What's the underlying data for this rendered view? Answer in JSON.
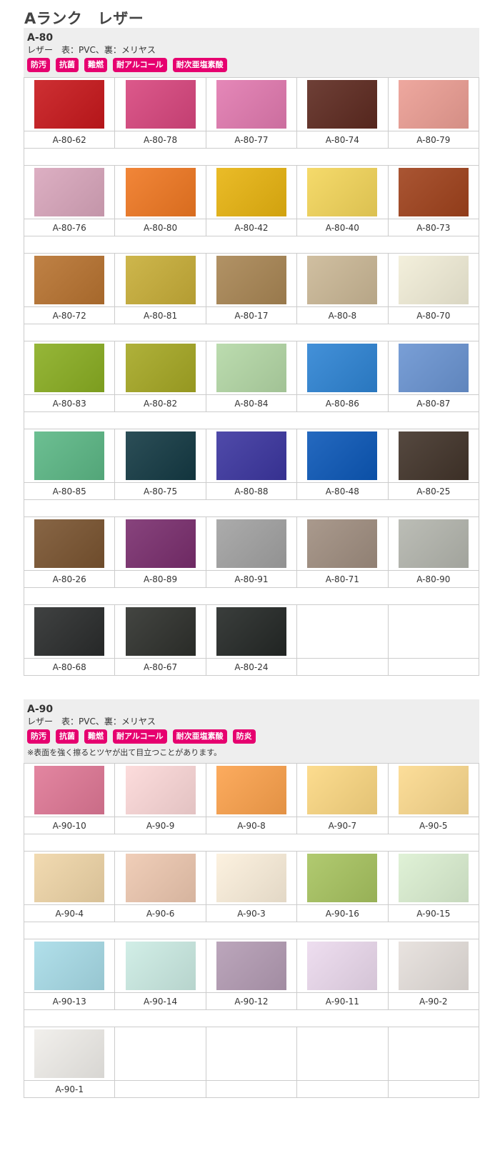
{
  "page_title": "Aランク　レザー",
  "sections": [
    {
      "title": "A-80",
      "spec": "レザー　表：PVC、裏：メリヤス",
      "tags": [
        "防汚",
        "抗菌",
        "難燃",
        "耐アルコール",
        "耐次亜塩素酸"
      ],
      "note": "",
      "rows": [
        [
          {
            "code": "A-80-62",
            "color": "#c8181c"
          },
          {
            "code": "A-80-78",
            "color": "#d8467e"
          },
          {
            "code": "A-80-77",
            "color": "#e27ab0"
          },
          {
            "code": "A-80-74",
            "color": "#5e2a20"
          },
          {
            "code": "A-80-79",
            "color": "#ec9e94"
          }
        ],
        [
          {
            "code": "A-80-76",
            "color": "#d9a6bc"
          },
          {
            "code": "A-80-80",
            "color": "#f07822"
          },
          {
            "code": "A-80-42",
            "color": "#e8b410"
          },
          {
            "code": "A-80-40",
            "color": "#f4d65a"
          },
          {
            "code": "A-80-73",
            "color": "#a0421c"
          }
        ],
        [
          {
            "code": "A-80-72",
            "color": "#b87330"
          },
          {
            "code": "A-80-81",
            "color": "#c8ae38"
          },
          {
            "code": "A-80-17",
            "color": "#a98654"
          },
          {
            "code": "A-80-8",
            "color": "#cbb896"
          },
          {
            "code": "A-80-70",
            "color": "#f2eed8"
          }
        ],
        [
          {
            "code": "A-80-83",
            "color": "#8aae22"
          },
          {
            "code": "A-80-82",
            "color": "#a6a824"
          },
          {
            "code": "A-80-84",
            "color": "#b4d8a6"
          },
          {
            "code": "A-80-86",
            "color": "#2e84d4"
          },
          {
            "code": "A-80-87",
            "color": "#6a94d2"
          }
        ],
        [
          {
            "code": "A-80-85",
            "color": "#5cb886"
          },
          {
            "code": "A-80-75",
            "color": "#143a44"
          },
          {
            "code": "A-80-88",
            "color": "#3c36a0"
          },
          {
            "code": "A-80-48",
            "color": "#0c58b8"
          },
          {
            "code": "A-80-25",
            "color": "#42342a"
          }
        ],
        [
          {
            "code": "A-80-26",
            "color": "#7a5430"
          },
          {
            "code": "A-80-89",
            "color": "#7a2e6e"
          },
          {
            "code": "A-80-91",
            "color": "#a2a2a2"
          },
          {
            "code": "A-80-71",
            "color": "#a08e80"
          },
          {
            "code": "A-80-90",
            "color": "#b4b6ae"
          }
        ],
        [
          {
            "code": "A-80-68",
            "color": "#2a2c2c"
          },
          {
            "code": "A-80-67",
            "color": "#2e302c"
          },
          {
            "code": "A-80-24",
            "color": "#242826"
          },
          null,
          null
        ]
      ]
    },
    {
      "title": "A-90",
      "spec": "レザー　表：PVC、裏：メリヤス",
      "tags": [
        "防汚",
        "抗菌",
        "難燃",
        "耐アルコール",
        "耐次亜塩素酸",
        "防炎"
      ],
      "note": "※表面を強く擦るとツヤが出て目立つことがあります。",
      "rows": [
        [
          {
            "code": "A-90-10",
            "color": "#e07896"
          },
          {
            "code": "A-90-9",
            "color": "#fcd8d8"
          },
          {
            "code": "A-90-8",
            "color": "#fca24c"
          },
          {
            "code": "A-90-7",
            "color": "#fcd882"
          },
          {
            "code": "A-90-5",
            "color": "#fcda8e"
          }
        ],
        [
          {
            "code": "A-90-4",
            "color": "#f0d6a8"
          },
          {
            "code": "A-90-6",
            "color": "#eec8b0"
          },
          {
            "code": "A-90-3",
            "color": "#fcf0dc"
          },
          {
            "code": "A-90-16",
            "color": "#a8c460"
          },
          {
            "code": "A-90-15",
            "color": "#dcf0d2"
          }
        ],
        [
          {
            "code": "A-90-13",
            "color": "#a8dce8"
          },
          {
            "code": "A-90-14",
            "color": "#ccece4"
          },
          {
            "code": "A-90-12",
            "color": "#b49cb4"
          },
          {
            "code": "A-90-11",
            "color": "#ecdaee"
          },
          {
            "code": "A-90-2",
            "color": "#e6e0dc"
          }
        ],
        [
          {
            "code": "A-90-1",
            "color": "#f0eeea"
          },
          null,
          null,
          null,
          null
        ]
      ]
    }
  ]
}
